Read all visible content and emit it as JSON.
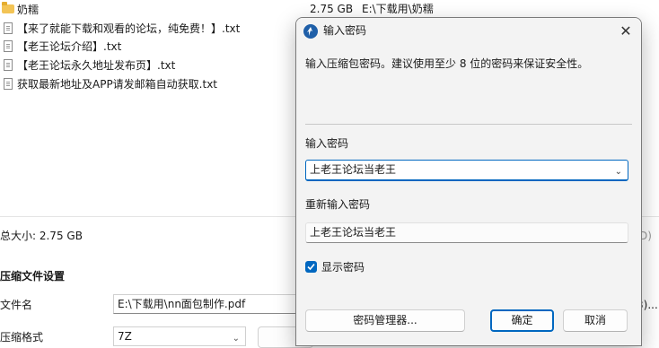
{
  "background": {
    "files": [
      {
        "name": "奶糯",
        "size": "2.75 GB",
        "path": "E:\\下载用\\奶糯",
        "icon": "folder-icon"
      },
      {
        "name": "【来了就能下载和观看的论坛，纯免费！】.txt",
        "icon": "text-file-icon"
      },
      {
        "name": "【老王论坛介绍】.txt",
        "icon": "text-file-icon"
      },
      {
        "name": "【老王论坛永久地址发布页】.txt",
        "icon": "text-file-icon"
      },
      {
        "name": "获取最新地址及APP请发邮箱自动获取.txt",
        "icon": "text-file-icon"
      }
    ],
    "total_size": "总大小: 2.75 GB",
    "right_fragment": "D)",
    "section_title": "压缩文件设置",
    "filename_label": "文件名",
    "filename_value": "E:\\下载用\\nn面包制作.pdf",
    "format_label": "压缩格式",
    "format_value": "7Z",
    "browse_fragment": "3)..."
  },
  "dialog": {
    "title": "输入密码",
    "description": "输入压缩包密码。建议使用至少 8 位的密码来保证安全性。",
    "password_label": "输入密码",
    "password_value": "上老王论坛当老王",
    "reenter_label": "重新输入密码",
    "reenter_value": "上老王论坛当老王",
    "show_password_label": "显示密码",
    "show_password_checked": true,
    "password_manager_button": "密码管理器...",
    "ok_button": "确定",
    "cancel_button": "取消",
    "close_icon": "close-icon"
  },
  "colors": {
    "accent": "#0067c0",
    "dialog_bg": "#f3f3f3",
    "folder": "#f3c455"
  }
}
